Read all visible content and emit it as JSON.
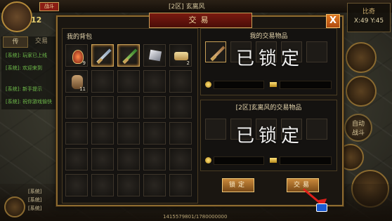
{
  "hud": {
    "server_banner": "[2区] 玄离风",
    "red_label": "战斗",
    "level": "12",
    "map_name": "比奇",
    "coords": "X:49 Y:45",
    "left_tabs": [
      "传",
      "交易"
    ],
    "chat_lines": [
      "[系统]: 玩家已上线",
      "[系统]: 欢迎来到",
      "[系统]: 新手提示",
      "[系统]: 祝你游戏愉快"
    ],
    "auto_label": "自动\n战斗",
    "bottom_chat": [
      "[系统]",
      "[系统]",
      "[系统]"
    ],
    "exp": "1415579801/1780000000"
  },
  "trade": {
    "title": "交易",
    "close_label": "X",
    "bag_title": "我的背包",
    "my_items_title": "我的交易物品",
    "other_items_title": "[2区]玄离风的交易物品",
    "locked_text": "已锁定",
    "lock_button": "锁定",
    "trade_button": "交易",
    "bag_items": [
      {
        "slot": 0,
        "type": "potion",
        "count": "9"
      },
      {
        "slot": 1,
        "type": "sword",
        "count": ""
      },
      {
        "slot": 2,
        "type": "sword-green",
        "count": ""
      },
      {
        "slot": 3,
        "type": "ore",
        "count": ""
      },
      {
        "slot": 4,
        "type": "scroll",
        "count": "2"
      },
      {
        "slot": 5,
        "type": "pouch",
        "count": "11"
      }
    ],
    "bag_rows": 6,
    "bag_cols": 5,
    "my_offer_first_item": "sword",
    "my_offer": {
      "gold": "",
      "ingot": ""
    },
    "other_offer": {
      "gold": "",
      "ingot": ""
    }
  },
  "icons": [
    "close-icon",
    "coin-icon",
    "gold-ingot-icon",
    "sword-icon",
    "potion-icon",
    "ore-icon",
    "scroll-icon",
    "pouch-icon",
    "arrow-hint-icon"
  ]
}
